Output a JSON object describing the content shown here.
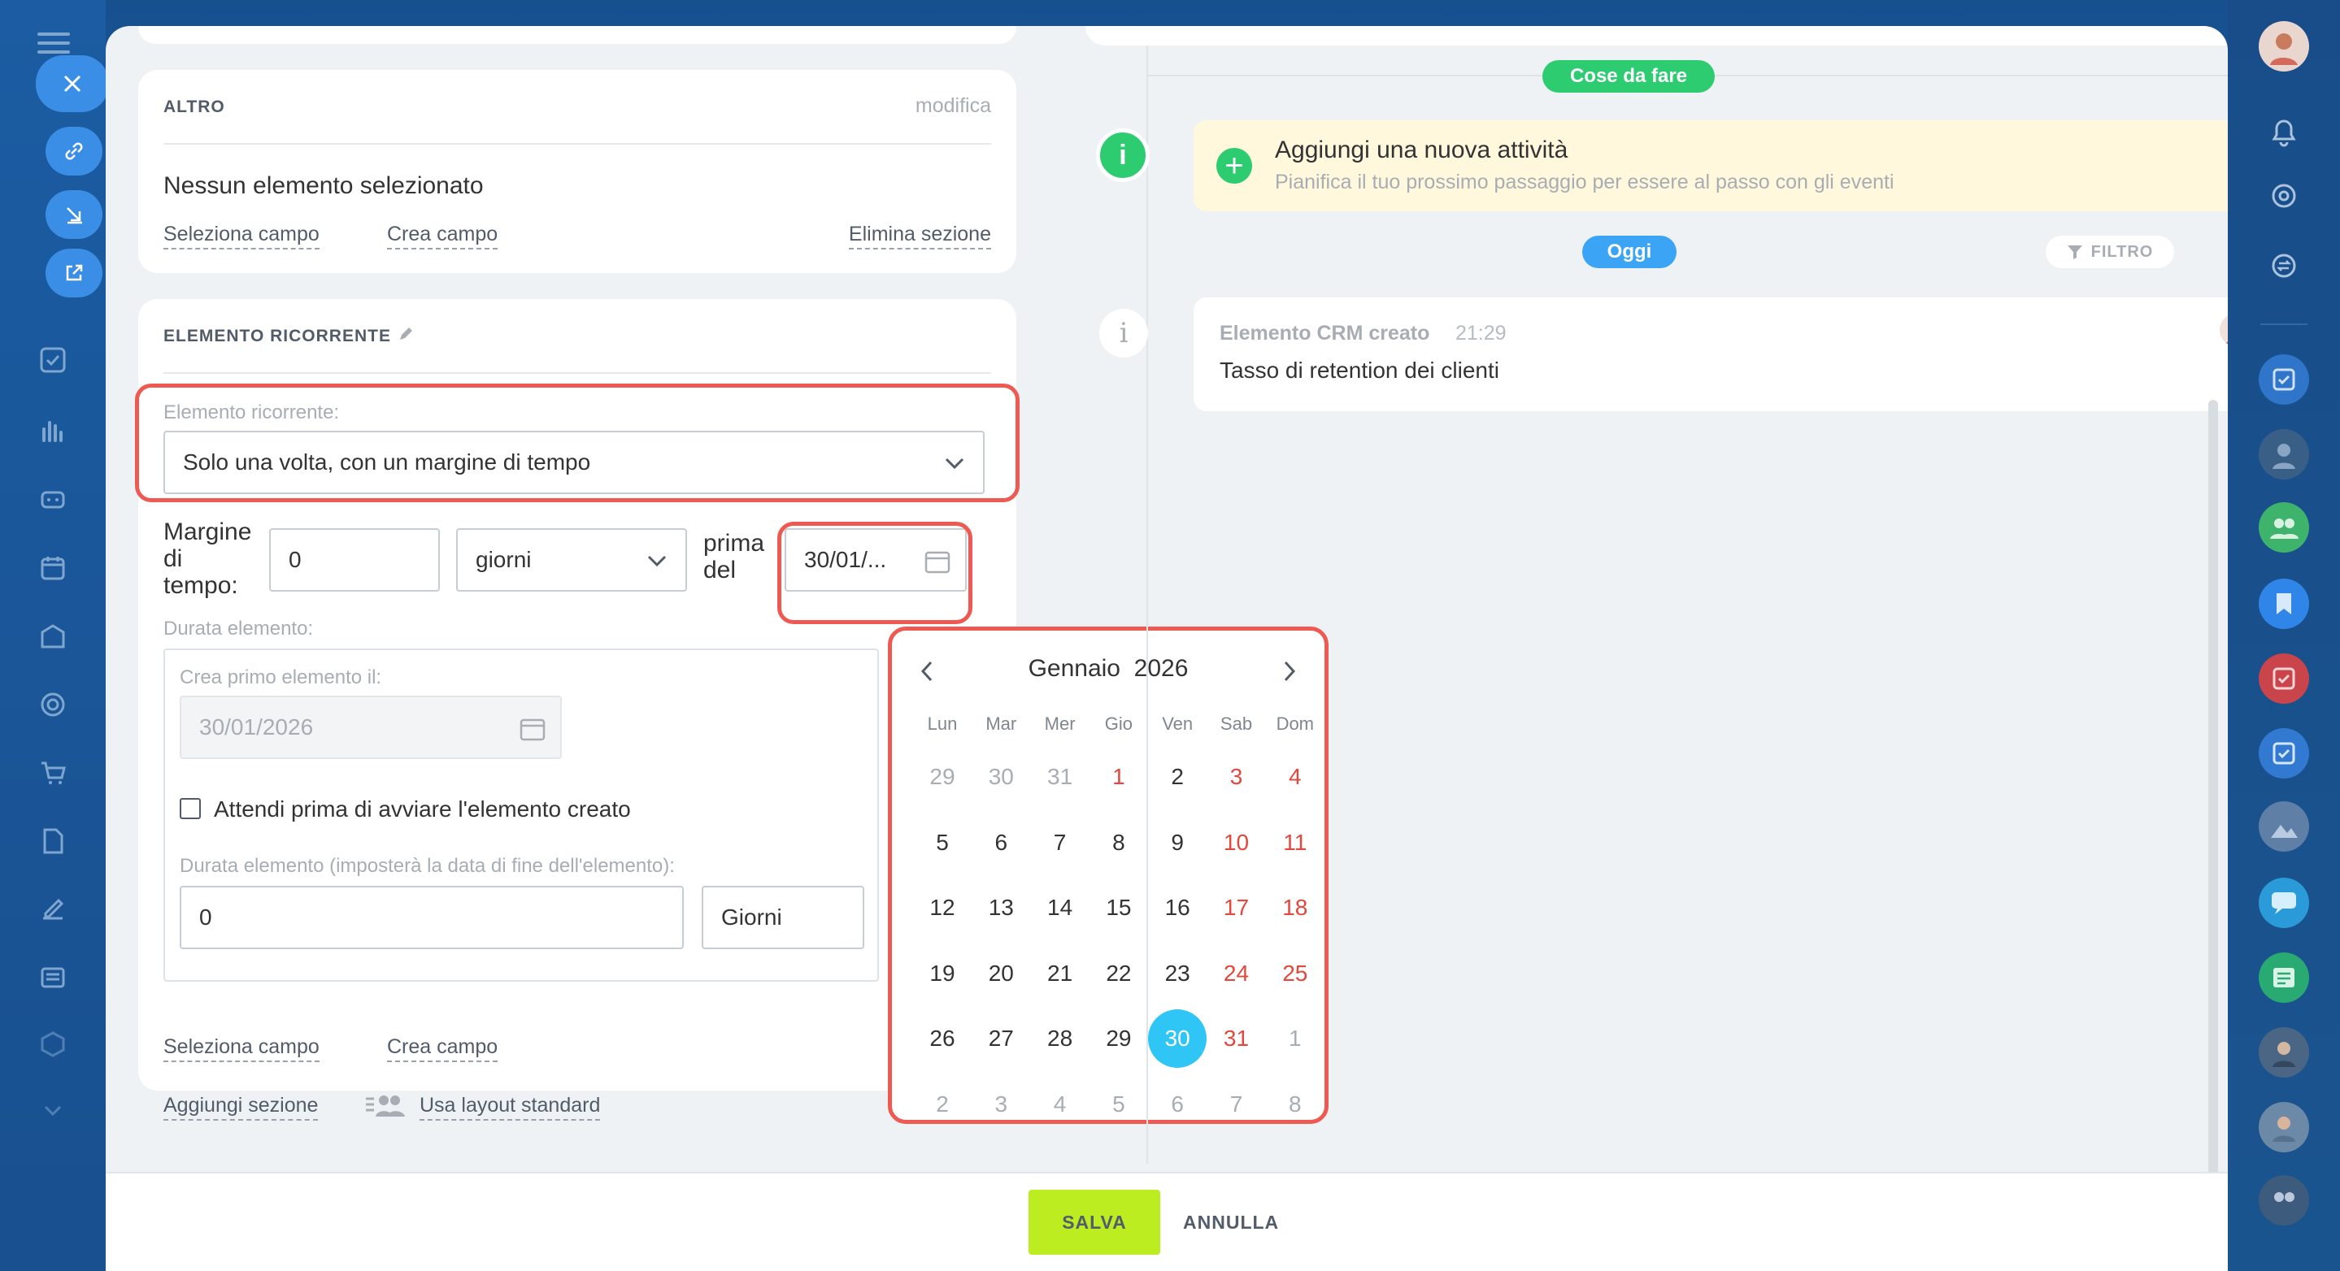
{
  "colors": {
    "accent": "#2fc6f6",
    "highlight": "#ee5a52",
    "save": "#bbed21",
    "todo": "#2ecc71",
    "today": "#3ca4f4"
  },
  "sections": {
    "altro": {
      "caption": "ALTRO",
      "edit": "modifica",
      "empty": "Nessun elemento selezionato",
      "select_field": "Seleziona campo",
      "create_field": "Crea campo",
      "delete_section": "Elimina sezione"
    },
    "recurring": {
      "caption": "ELEMENTO RICORRENTE",
      "type_label": "Elemento ricorrente:",
      "type_value": "Solo una volta, con un margine di tempo",
      "margin_label": "Margine di tempo:",
      "margin_value": "0",
      "unit_value": "giorni",
      "before_label": "prima del",
      "date_value": "30/01/...",
      "duration_label": "Durata elemento:",
      "first_label": "Crea primo elemento il:",
      "first_value": "30/01/2026",
      "wait_label": "Attendi prima di avviare l'elemento creato",
      "duration_field_label": "Durata elemento (imposterà la data di fine dell'elemento):",
      "duration_value": "0",
      "duration_unit": "Giorni",
      "select_field": "Seleziona campo",
      "create_field": "Crea campo"
    }
  },
  "bottom_links": {
    "add_section": "Aggiungi sezione",
    "standard_layout": "Usa layout standard"
  },
  "calendar": {
    "month": "Gennaio",
    "year": "2026",
    "weekdays": [
      "Lun",
      "Mar",
      "Mer",
      "Gio",
      "Ven",
      "Sab",
      "Dom"
    ],
    "weeks": [
      [
        "29",
        "30",
        "31",
        "1",
        "2",
        "3",
        "4"
      ],
      [
        "5",
        "6",
        "7",
        "8",
        "9",
        "10",
        "11"
      ],
      [
        "12",
        "13",
        "14",
        "15",
        "16",
        "17",
        "18"
      ],
      [
        "19",
        "20",
        "21",
        "22",
        "23",
        "24",
        "25"
      ],
      [
        "26",
        "27",
        "28",
        "29",
        "30",
        "31",
        "1"
      ],
      [
        "2",
        "3",
        "4",
        "5",
        "6",
        "7",
        "8"
      ]
    ],
    "selected": "30"
  },
  "timeline": {
    "todo_badge": "Cose da fare",
    "add_title": "Aggiungi una nuova attività",
    "add_sub": "Pianifica il tuo prossimo passaggio per essere al passo con gli eventi",
    "today_badge": "Oggi",
    "filter": "FILTRO",
    "event_title": "Elemento CRM creato",
    "event_time": "21:29",
    "event_text": "Tasso di retention dei clienti"
  },
  "footer": {
    "save": "SALVA",
    "cancel": "ANNULLA"
  }
}
